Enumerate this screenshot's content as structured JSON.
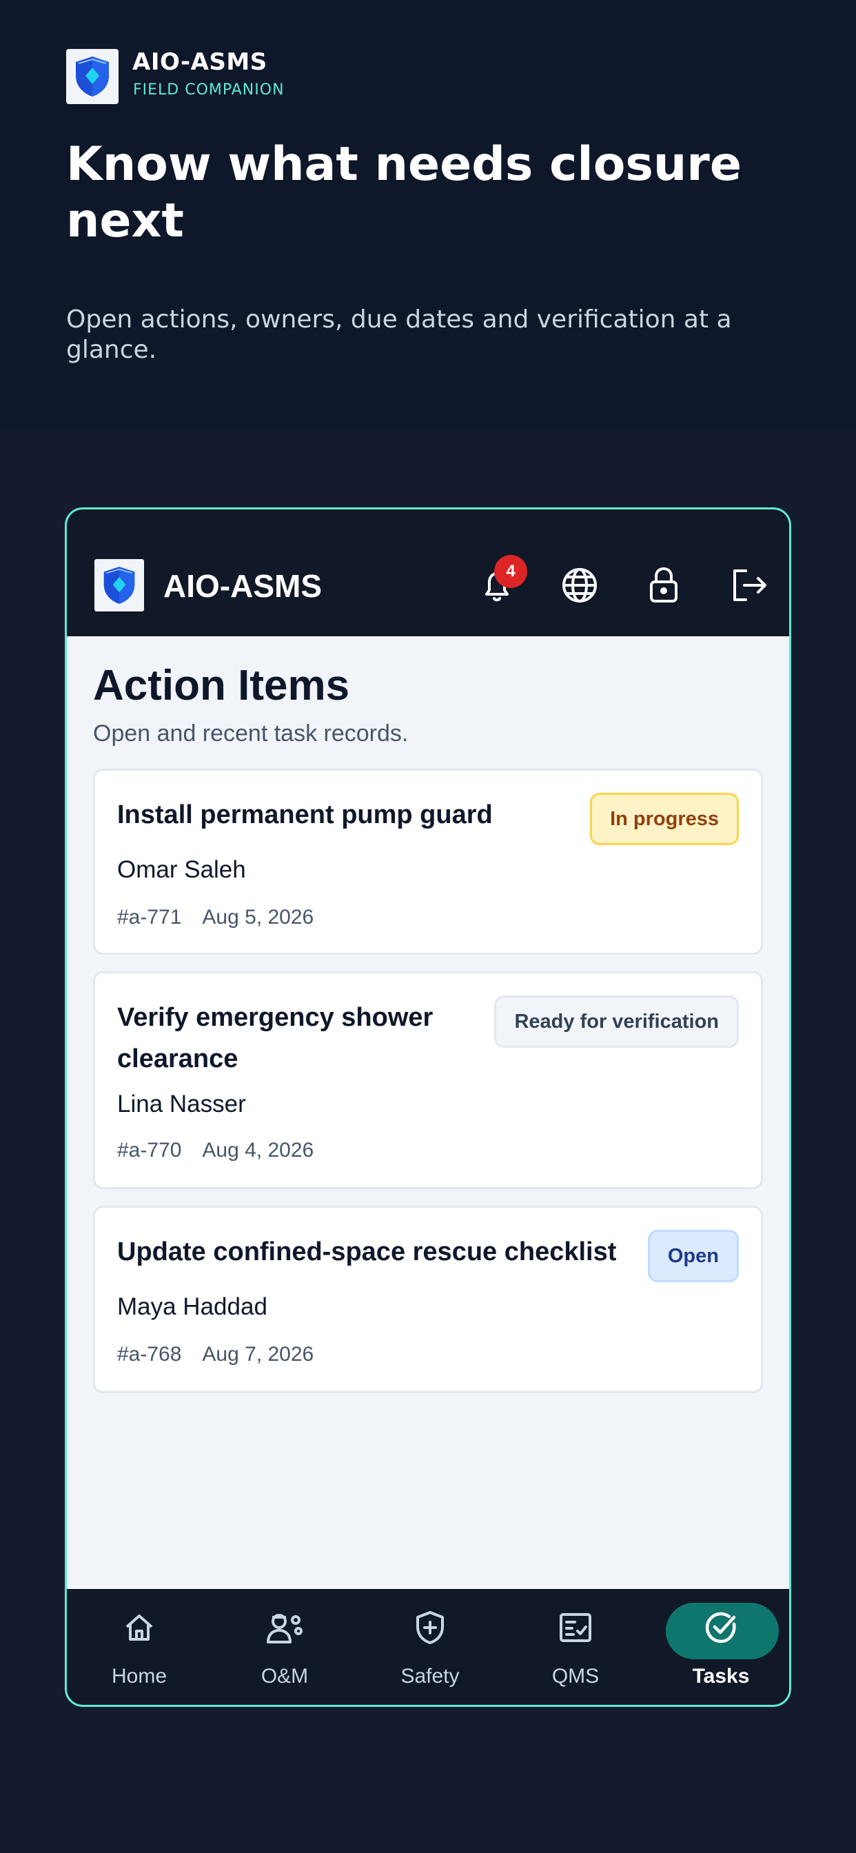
{
  "brand": {
    "name": "AIO-ASMS",
    "subtitle": "FIELD COMPANION"
  },
  "hero": {
    "title": "Know what needs closure next",
    "description": "Open actions, owners, due dates and verification at a glance."
  },
  "app": {
    "header": {
      "title": "AIO-ASMS",
      "notification_count": "4",
      "icons": [
        "bell-icon",
        "globe-icon",
        "lock-icon",
        "logout-icon"
      ]
    },
    "page": {
      "title": "Action Items",
      "subtitle": "Open and recent task records."
    },
    "tasks": [
      {
        "title": "Install permanent pump guard",
        "owner": "Omar Saleh",
        "id": "#a-771",
        "date": "Aug 5, 2026",
        "status": "In progress"
      },
      {
        "title": "Verify emergency shower clearance",
        "owner": "Lina Nasser",
        "id": "#a-770",
        "date": "Aug 4, 2026",
        "status": "Ready for verification"
      },
      {
        "title": "Update confined-space rescue checklist",
        "owner": "Maya Haddad",
        "id": "#a-768",
        "date": "Aug 7, 2026",
        "status": "Open"
      }
    ],
    "nav": [
      {
        "label": "Home",
        "icon": "home-icon"
      },
      {
        "label": "O&M",
        "icon": "worker-gear-icon"
      },
      {
        "label": "Safety",
        "icon": "shield-plus-icon"
      },
      {
        "label": "QMS",
        "icon": "checklist-icon"
      },
      {
        "label": "Tasks",
        "icon": "check-circle-icon",
        "active": true
      }
    ]
  },
  "colors": {
    "accent": "#5eead4",
    "active_nav": "#0f766e",
    "status_in_progress_bg": "#fef3c7",
    "status_ready_bg": "#f1f5f9",
    "status_open_bg": "#dbeafe",
    "badge": "#dc2626"
  }
}
